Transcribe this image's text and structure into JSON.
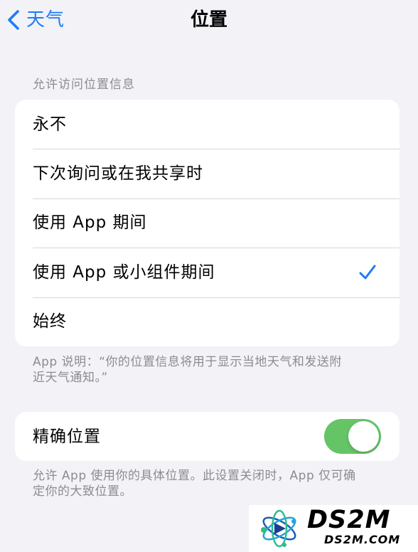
{
  "nav": {
    "back_icon": "chevron-left-icon",
    "back_label": "天气",
    "title": "位置"
  },
  "location_access": {
    "header": "允许访问位置信息",
    "options": [
      {
        "label": "永不",
        "selected": false
      },
      {
        "label": "下次询问或在我共享时",
        "selected": false
      },
      {
        "label": "使用 App 期间",
        "selected": false
      },
      {
        "label": "使用 App 或小组件期间",
        "selected": true
      },
      {
        "label": "始终",
        "selected": false
      }
    ],
    "selected_icon": "checkmark-icon",
    "footnote_lines": [
      "App 说明：“你的位置信息将用于显示当地天气和发送附",
      "近天气通知。”"
    ]
  },
  "precise_location": {
    "label": "精确位置",
    "enabled": true,
    "footnote_lines": [
      "允许 App 使用你的具体位置。此设置关闭时，App 仅可确",
      "定你的大致位置。"
    ]
  },
  "watermark": {
    "brand": "DS2M",
    "url": "DS2M.COM",
    "icon": "atom-logo"
  },
  "colors": {
    "accent": "#1f7cf7",
    "background": "#f2f2f7",
    "toggle_on": "#65c466",
    "secondary_text": "#8b8b91"
  }
}
